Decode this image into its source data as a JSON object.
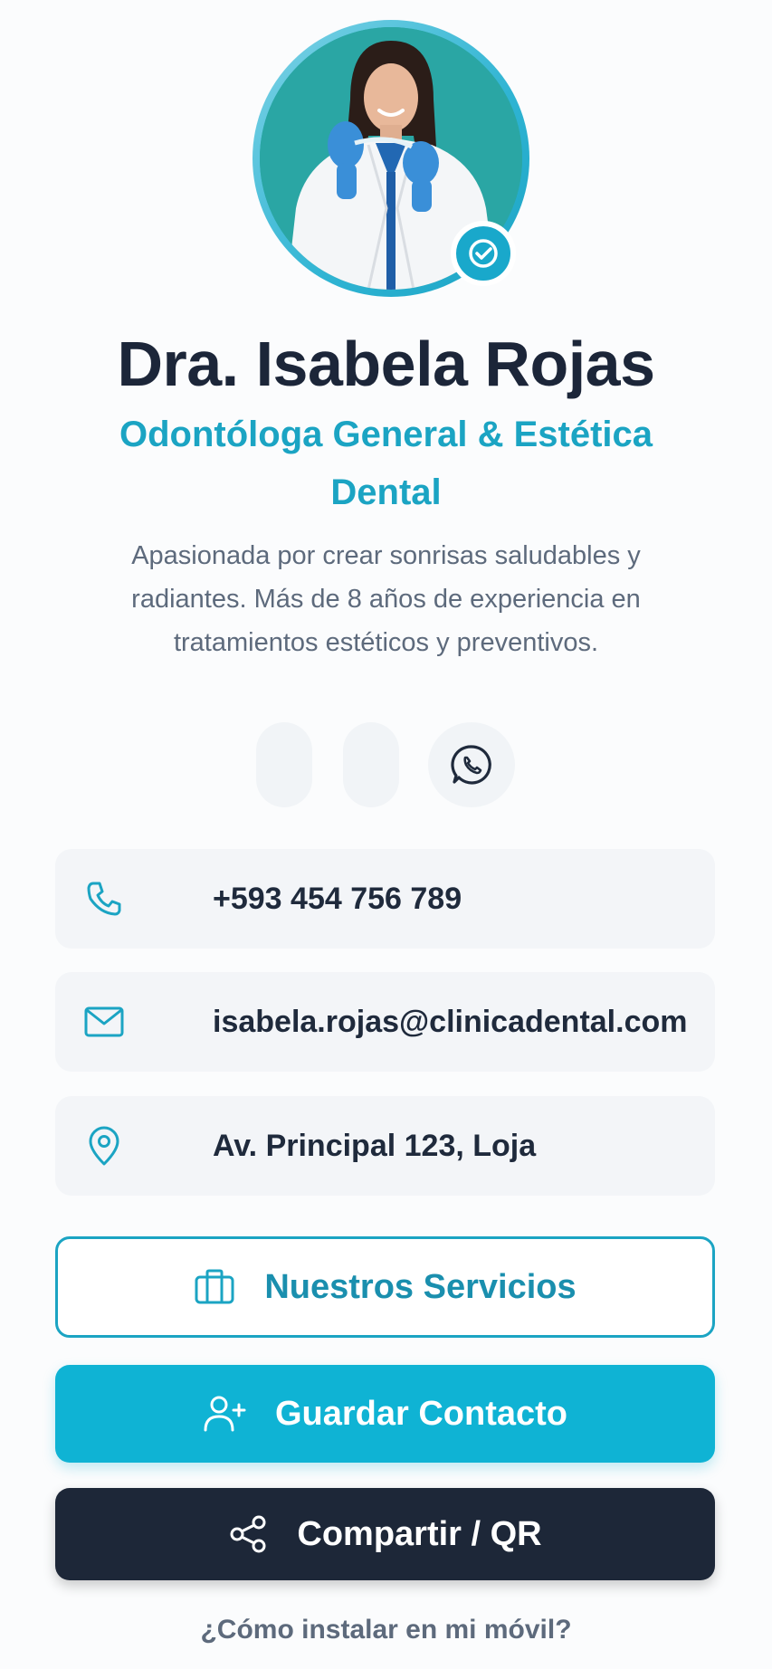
{
  "profile": {
    "name": "Dra. Isabela Rojas",
    "role": "Odontóloga General & Estética Dental",
    "bio": "Apasionada por crear sonrisas saludables y radiantes. Más de 8 años de experiencia en tratamientos estéticos y preventivos."
  },
  "social": {
    "items": [
      {
        "icon": "empty-pill-icon"
      },
      {
        "icon": "empty-pill-icon"
      },
      {
        "icon": "whatsapp-icon"
      }
    ]
  },
  "contact": {
    "phone": "+593 454 756 789",
    "email": "isabela.rojas@clinicadental.com",
    "address": "Av. Principal 123, Loja"
  },
  "actions": {
    "services_label": "Nuestros Servicios",
    "save_label": "Guardar Contacto",
    "share_label": "Compartir / QR",
    "install_label": "¿Cómo instalar en mi móvil?"
  },
  "colors": {
    "accent": "#1ba4c3",
    "primary_button": "#0fb3d4",
    "dark_button": "#1d2738",
    "title": "#1c2639",
    "muted_text": "#5d6a7c"
  }
}
